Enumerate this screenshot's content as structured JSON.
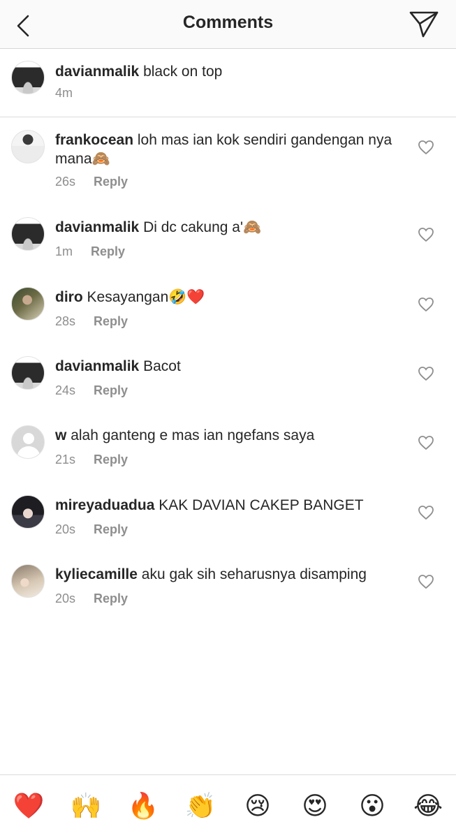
{
  "header": {
    "title": "Comments",
    "back_icon": "chevron-left-icon",
    "send_icon": "paper-plane-icon"
  },
  "caption": {
    "username": "davianmalik",
    "text": "black on top",
    "time": "4m"
  },
  "comments": [
    {
      "username": "frankocean",
      "text": "loh mas ian kok sendiri gandengan nya mana🙈",
      "time": "26s",
      "reply": "Reply"
    },
    {
      "username": "davianmalik",
      "text": "Di dc cakung a'🙈",
      "time": "1m",
      "reply": "Reply"
    },
    {
      "username": "diro",
      "text": "Kesayangan🤣❤️",
      "time": "28s",
      "reply": "Reply"
    },
    {
      "username": "davianmalik",
      "text": "Bacot",
      "time": "24s",
      "reply": "Reply"
    },
    {
      "username": "w",
      "text": "alah ganteng e mas ian ngefans saya",
      "time": "21s",
      "reply": "Reply"
    },
    {
      "username": "mireyaduadua",
      "text": "KAK DAVIAN CAKEP BANGET",
      "time": "20s",
      "reply": "Reply"
    },
    {
      "username": "kyliecamille",
      "text": "aku gak sih seharusnya disamping",
      "time": "20s",
      "reply": "Reply"
    }
  ],
  "reactions": [
    "❤️",
    "🙌",
    "🔥",
    "👏",
    "😢",
    "😍",
    "😮",
    "😂"
  ],
  "colors": {
    "text": "#262626",
    "secondary": "#8e8e8e",
    "divider": "#dbdbdb",
    "header_bg": "#fafafa"
  }
}
